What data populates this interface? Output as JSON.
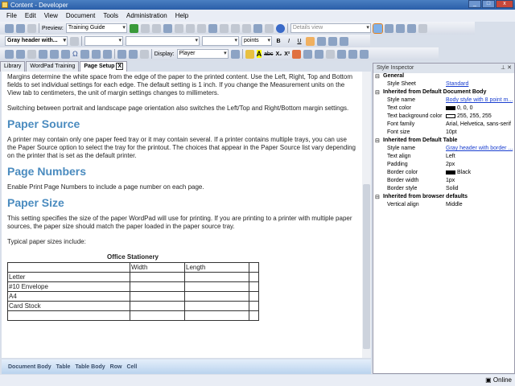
{
  "window": {
    "title": "Content - Developer"
  },
  "menu": [
    "File",
    "Edit",
    "View",
    "Document",
    "Tools",
    "Administration",
    "Help"
  ],
  "toolbar": {
    "preview_label": "Preview:",
    "preview_value": "Training Guide",
    "view_select": "Details view",
    "style_select": "Gray header with...",
    "units": "points",
    "display_label": "Display:",
    "display_value": "Player"
  },
  "tabs": [
    {
      "label": "Library"
    },
    {
      "label": "WordPad Training"
    },
    {
      "label": "Page Setup",
      "close": "X"
    }
  ],
  "document": {
    "p1": "Margins determine the white space from the edge of the paper to the printed content. Use the Left, Right, Top and Bottom fields to set individual settings for each edge. The default setting is 1 inch. If you change the Measurement units on the View tab to centimeters, the unit of margin settings changes to millimeters.",
    "p2": "Switching between portrait and landscape page orientation also switches the Left/Top and Right/Bottom margin settings.",
    "h_source": "Paper Source",
    "p3": "A printer may contain only one paper feed tray or it may contain several. If a printer contains multiple trays, you can use the Paper Source option to select the tray for the printout. The choices that appear in the Paper Source list vary depending on the printer that is set as the default printer.",
    "h_numbers": "Page Numbers",
    "p4": "Enable Print Page Numbers to include a page number on each page.",
    "h_size": "Paper Size",
    "p5": "This setting specifies the size of the paper WordPad will use for printing. If you are printing to a printer with multiple paper sources, the paper size should match the paper loaded in the paper source tray.",
    "p6": "Typical paper sizes include:",
    "table": {
      "caption": "Office Stationery",
      "headers": [
        "",
        "Width",
        "Length",
        ""
      ],
      "rows": [
        [
          "Letter",
          "",
          "",
          ""
        ],
        [
          "#10 Envelope",
          "",
          "",
          ""
        ],
        [
          "A4",
          "",
          "",
          ""
        ],
        [
          "Card Stock",
          "",
          "",
          ""
        ],
        [
          "",
          "",
          "",
          ""
        ]
      ]
    }
  },
  "breadcrumb": [
    "Document Body",
    "Table",
    "Table Body",
    "Row",
    "Cell"
  ],
  "status": "Online",
  "inspector": {
    "title": "Style Inspector",
    "groups": [
      {
        "name": "General",
        "props": [
          {
            "k": "Style Sheet",
            "v": "Standard",
            "link": true
          }
        ]
      },
      {
        "name": "Inherited from Default Document Body",
        "props": [
          {
            "k": "Style name",
            "v": "Body style with 8 point m...",
            "link": true
          },
          {
            "k": "Text color",
            "v": "0, 0, 0",
            "swatch": "#000000"
          },
          {
            "k": "Text background color",
            "v": "255, 255, 255",
            "swatch": "#ffffff"
          },
          {
            "k": "Font family",
            "v": "Arial, Helvetica, sans-serif"
          },
          {
            "k": "Font size",
            "v": "10pt"
          }
        ]
      },
      {
        "name": "Inherited from Default Table",
        "props": [
          {
            "k": "Style name",
            "v": "Gray header with border ...",
            "link": true
          },
          {
            "k": "Text align",
            "v": "Left"
          },
          {
            "k": "Padding",
            "v": "2px"
          },
          {
            "k": "Border color",
            "v": "Black",
            "swatch": "#000000"
          },
          {
            "k": "Border width",
            "v": "1px"
          },
          {
            "k": "Border style",
            "v": "Solid"
          }
        ]
      },
      {
        "name": "Inherited from browser defaults",
        "props": [
          {
            "k": "Vertical align",
            "v": "Middle"
          }
        ]
      }
    ]
  }
}
